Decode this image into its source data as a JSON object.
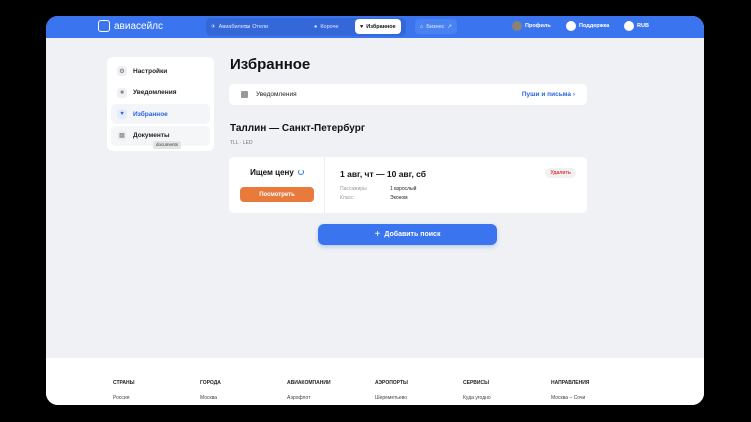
{
  "header": {
    "logo": "авиасейлс",
    "tabs": [
      {
        "label": "Авиабилеты",
        "icon": "plane-icon"
      },
      {
        "label": "Отели",
        "icon": "bed-icon"
      },
      {
        "label": "Короче",
        "icon": "pin-icon"
      },
      {
        "label": "Избранное",
        "icon": "heart-icon",
        "active": true
      },
      {
        "label": "Бизнес",
        "icon": "briefcase-icon",
        "suffix": "↗"
      }
    ],
    "profile": "Профиль",
    "support": "Поддержка",
    "currency": "RUB"
  },
  "sidebar": {
    "items": [
      {
        "label": "Настройки",
        "icon": "gear-icon"
      },
      {
        "label": "Уведомления",
        "icon": "notification-icon"
      },
      {
        "label": "Избранное",
        "icon": "heart-icon",
        "active": true
      },
      {
        "label": "Документы",
        "icon": "document-icon"
      }
    ],
    "tooltip": "documents"
  },
  "main": {
    "title": "Избранное",
    "notifications": {
      "label": "Уведомления",
      "link": "Пуши и письма ›"
    },
    "route": {
      "title": "Таллин — Санкт-Петербург",
      "codes": "TLL · LED"
    },
    "card": {
      "status": "Ищем цену",
      "view": "Посмотреть",
      "dates": "1 авг, чт — 10 авг, сб",
      "passengers_label": "Пассажиры",
      "passengers": "1 взрослый",
      "class_label": "Класс",
      "class": "Эконом",
      "delete": "Удалить"
    },
    "add_search": "Добавить поиск"
  },
  "footer": {
    "columns": [
      {
        "heading": "СТРАНЫ",
        "link": "Россия"
      },
      {
        "heading": "ГОРОДА",
        "link": "Москва"
      },
      {
        "heading": "АВИАКОМПАНИИ",
        "link": "Аэрофлот"
      },
      {
        "heading": "АЭРОПОРТЫ",
        "link": "Шереметьево"
      },
      {
        "heading": "СЕРВИСЫ",
        "link": "Куда угодно"
      },
      {
        "heading": "НАПРАВЛЕНИЯ",
        "link": "Москва – Сочи"
      }
    ]
  },
  "colors": {
    "brand": "#3b74ef",
    "orange": "#e87a3c",
    "delete": "#e0413b"
  }
}
